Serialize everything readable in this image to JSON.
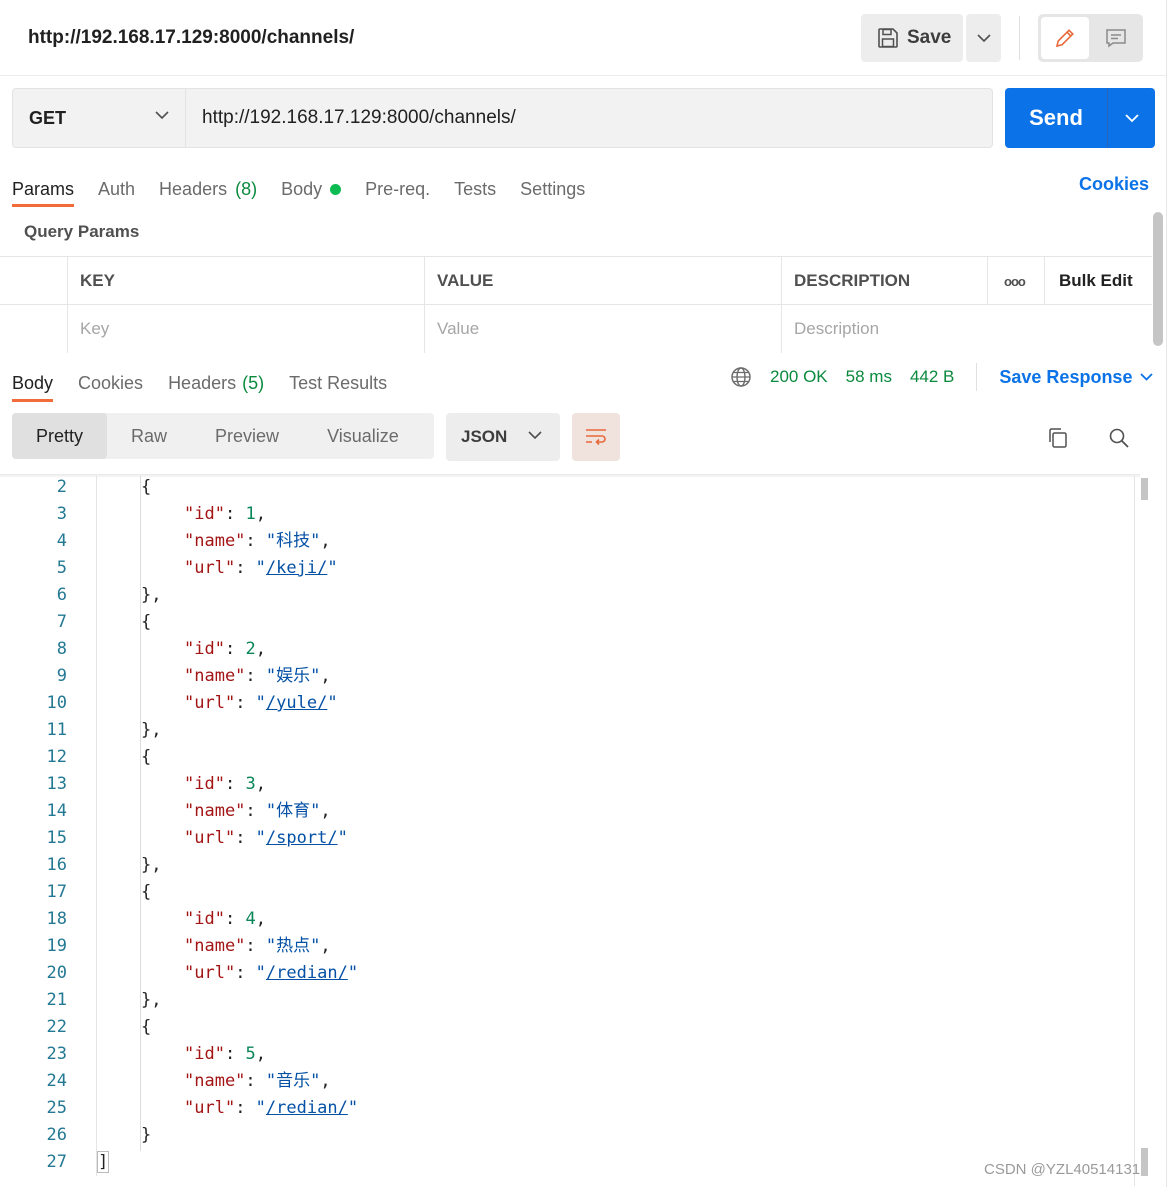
{
  "tab": {
    "title": "http://192.168.17.129:8000/channels/"
  },
  "toolbar": {
    "save_label": "Save"
  },
  "request": {
    "method": "GET",
    "url": "http://192.168.17.129:8000/channels/",
    "send_label": "Send"
  },
  "request_tabs": {
    "params": "Params",
    "auth": "Auth",
    "headers": "Headers",
    "headers_count": "(8)",
    "body": "Body",
    "prereq": "Pre-req.",
    "tests": "Tests",
    "settings": "Settings",
    "cookies": "Cookies"
  },
  "query_params": {
    "title": "Query Params",
    "headers": {
      "key": "KEY",
      "value": "VALUE",
      "description": "DESCRIPTION",
      "more": "ooo",
      "bulk": "Bulk Edit"
    },
    "placeholders": {
      "key": "Key",
      "value": "Value",
      "description": "Description"
    }
  },
  "response_tabs": {
    "body": "Body",
    "cookies": "Cookies",
    "headers": "Headers",
    "headers_count": "(5)",
    "test_results": "Test Results"
  },
  "response_meta": {
    "status": "200 OK",
    "time": "58 ms",
    "size": "442 B",
    "save_response": "Save Response"
  },
  "view_options": [
    "Pretty",
    "Raw",
    "Preview",
    "Visualize"
  ],
  "format": "JSON",
  "code_lines": [
    {
      "n": "2",
      "indent": 1,
      "kind": "open"
    },
    {
      "n": "3",
      "indent": 2,
      "kind": "num",
      "key": "\"id\"",
      "val": "1"
    },
    {
      "n": "4",
      "indent": 2,
      "kind": "str",
      "key": "\"name\"",
      "val": "\"科技\""
    },
    {
      "n": "5",
      "indent": 2,
      "kind": "url",
      "key": "\"url\"",
      "val": "/keji/"
    },
    {
      "n": "6",
      "indent": 1,
      "kind": "close"
    },
    {
      "n": "7",
      "indent": 1,
      "kind": "open"
    },
    {
      "n": "8",
      "indent": 2,
      "kind": "num",
      "key": "\"id\"",
      "val": "2"
    },
    {
      "n": "9",
      "indent": 2,
      "kind": "str",
      "key": "\"name\"",
      "val": "\"娱乐\""
    },
    {
      "n": "10",
      "indent": 2,
      "kind": "url",
      "key": "\"url\"",
      "val": "/yule/"
    },
    {
      "n": "11",
      "indent": 1,
      "kind": "close"
    },
    {
      "n": "12",
      "indent": 1,
      "kind": "open"
    },
    {
      "n": "13",
      "indent": 2,
      "kind": "num",
      "key": "\"id\"",
      "val": "3"
    },
    {
      "n": "14",
      "indent": 2,
      "kind": "str",
      "key": "\"name\"",
      "val": "\"体育\""
    },
    {
      "n": "15",
      "indent": 2,
      "kind": "url",
      "key": "\"url\"",
      "val": "/sport/"
    },
    {
      "n": "16",
      "indent": 1,
      "kind": "close"
    },
    {
      "n": "17",
      "indent": 1,
      "kind": "open"
    },
    {
      "n": "18",
      "indent": 2,
      "kind": "num",
      "key": "\"id\"",
      "val": "4"
    },
    {
      "n": "19",
      "indent": 2,
      "kind": "str",
      "key": "\"name\"",
      "val": "\"热点\""
    },
    {
      "n": "20",
      "indent": 2,
      "kind": "url",
      "key": "\"url\"",
      "val": "/redian/"
    },
    {
      "n": "21",
      "indent": 1,
      "kind": "close"
    },
    {
      "n": "22",
      "indent": 1,
      "kind": "open"
    },
    {
      "n": "23",
      "indent": 2,
      "kind": "num",
      "key": "\"id\"",
      "val": "5"
    },
    {
      "n": "24",
      "indent": 2,
      "kind": "str",
      "key": "\"name\"",
      "val": "\"音乐\""
    },
    {
      "n": "25",
      "indent": 2,
      "kind": "url",
      "key": "\"url\"",
      "val": "/redian/"
    },
    {
      "n": "26",
      "indent": 1,
      "kind": "closelast"
    },
    {
      "n": "27",
      "indent": 0,
      "kind": "end"
    }
  ],
  "watermark": "CSDN @YZL40514131",
  "colors": {
    "accent": "#0b73e7",
    "tab_underline": "#f26b3a",
    "success": "#0b8a3e"
  }
}
